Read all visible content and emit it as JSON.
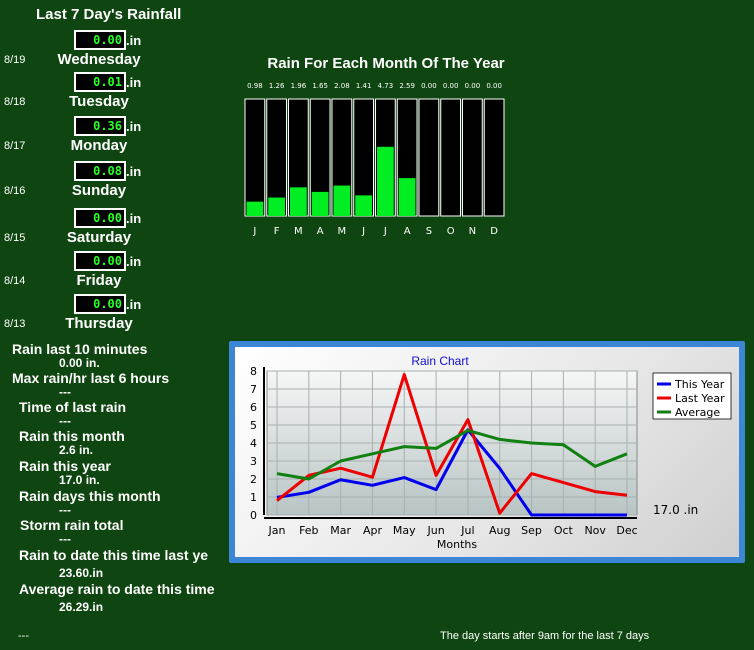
{
  "title": "Last 7 Day's Rainfall",
  "unit": ".in",
  "days": [
    {
      "date": "8/19",
      "value": "0.00",
      "name": "Wednesday"
    },
    {
      "date": "8/18",
      "value": "0.01",
      "name": "Tuesday"
    },
    {
      "date": "8/17",
      "value": "0.36",
      "name": "Monday"
    },
    {
      "date": "8/16",
      "value": "0.08",
      "name": "Sunday"
    },
    {
      "date": "8/15",
      "value": "0.00",
      "name": "Saturday"
    },
    {
      "date": "8/14",
      "value": "0.00",
      "name": "Friday"
    },
    {
      "date": "8/13",
      "value": "0.00",
      "name": "Thursday"
    }
  ],
  "stats": [
    {
      "label": "Rain last 10 minutes",
      "value": "0.00 in."
    },
    {
      "label": "Max rain/hr last 6 hours",
      "value": "---"
    },
    {
      "label": "Time of last rain",
      "value": "---"
    },
    {
      "label": "Rain this month",
      "value": "2.6 in."
    },
    {
      "label": "Rain this year",
      "value": "17.0 in."
    },
    {
      "label": "Rain days this month",
      "value": "---"
    },
    {
      "label": "Storm rain total",
      "value": "---"
    },
    {
      "label": "Rain to date this time last ye",
      "value": "23.60.in"
    },
    {
      "label": "Average rain to date this time",
      "value": "26.29.in"
    }
  ],
  "footer": {
    "left": "---",
    "right": "The day starts after 9am for the last 7 days"
  },
  "colors": {
    "background": "#0f4510",
    "bar": "#00ee22",
    "value_text": "#26ff26"
  },
  "chart_data": [
    {
      "type": "bar",
      "title": "Rain For Each Month Of The Year",
      "categories": [
        "J",
        "F",
        "M",
        "A",
        "M",
        "J",
        "J",
        "A",
        "S",
        "O",
        "N",
        "D"
      ],
      "values": [
        0.98,
        1.26,
        1.96,
        1.65,
        2.08,
        1.41,
        4.73,
        2.59,
        0.0,
        0.0,
        0.0,
        0.0
      ],
      "value_labels": [
        "0.98",
        "1.26",
        "1.96",
        "1.65",
        "2.08",
        "1.41",
        "4.73",
        "2.59",
        "0.00",
        "0.00",
        "0.00",
        "0.00"
      ],
      "ylim": [
        0,
        8
      ]
    },
    {
      "type": "line",
      "title": "Rain Chart",
      "xlabel": "Months",
      "ylabel": "",
      "categories": [
        "Jan",
        "Feb",
        "Mar",
        "Apr",
        "May",
        "Jun",
        "Jul",
        "Aug",
        "Sep",
        "Oct",
        "Nov",
        "Dec"
      ],
      "ylim": [
        0,
        8
      ],
      "yticks": [
        0,
        1,
        2,
        3,
        4,
        5,
        6,
        7,
        8
      ],
      "grid": true,
      "legend": "top-right",
      "annotation": "17.0 .in",
      "series": [
        {
          "name": "This Year",
          "color": "#0000ee",
          "values": [
            0.98,
            1.26,
            1.96,
            1.65,
            2.08,
            1.41,
            4.73,
            2.59,
            0,
            0,
            0,
            0
          ]
        },
        {
          "name": "Last Year",
          "color": "#ee0000",
          "values": [
            0.8,
            2.2,
            2.6,
            2.1,
            7.8,
            2.2,
            5.3,
            0.1,
            2.3,
            1.8,
            1.3,
            1.1
          ]
        },
        {
          "name": "Average",
          "color": "#108010",
          "values": [
            2.3,
            2.0,
            3.0,
            3.4,
            3.8,
            3.7,
            4.7,
            4.2,
            4.0,
            3.9,
            2.7,
            3.4
          ]
        }
      ]
    }
  ]
}
